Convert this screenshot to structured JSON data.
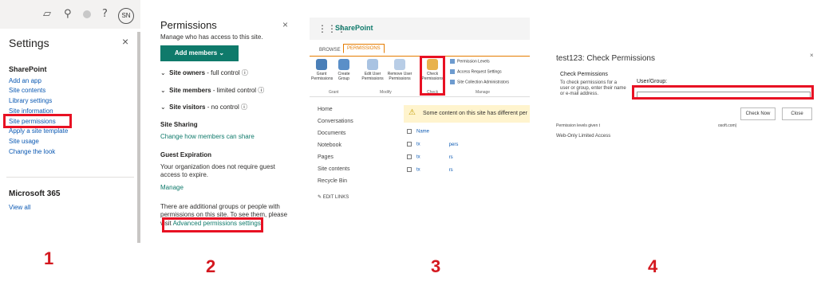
{
  "step_numbers": [
    "1",
    "2",
    "3",
    "4"
  ],
  "panel1": {
    "settings_title": "Settings",
    "close": "×",
    "avatar_initials": "SN",
    "help": "?",
    "section_sharepoint": "SharePoint",
    "items": [
      "Add an app",
      "Site contents",
      "Library settings",
      "Site information",
      "Site permissions",
      "Apply a site template",
      "Site usage",
      "Change the look"
    ],
    "section_m365": "Microsoft 365",
    "view_all": "View all"
  },
  "panel2": {
    "title": "Permissions",
    "close": "×",
    "subtitle": "Manage who has access to this site.",
    "add_members": "Add members ⌄",
    "groups": [
      {
        "name": "Site owners",
        "level": " - full control ⓘ"
      },
      {
        "name": "Site members",
        "level": " - limited control ⓘ"
      },
      {
        "name": "Site visitors",
        "level": " - no control ⓘ"
      }
    ],
    "site_sharing_heading": "Site Sharing",
    "site_sharing_link": "Change how members can share",
    "guest_heading": "Guest Expiration",
    "guest_text_1": "Your organization does not require guest",
    "guest_text_2": "access to expire.",
    "manage": "Manage",
    "additional_1": "There are additional groups or people with",
    "additional_2": "permissions on this site. To see them, please",
    "additional_3": "visit ",
    "advanced_link": "Advanced permissions settings",
    "period": "."
  },
  "panel3": {
    "brand": "SharePoint",
    "tabs": [
      "BROWSE",
      "PERMISSIONS"
    ],
    "ribbon_buttons": [
      "Grant Permissions",
      "Create Group",
      "Edit User Permissions",
      "Remove User Permissions",
      "Check Permissions"
    ],
    "ribbon_small": [
      "Permission Levels",
      "Access Request Settings",
      "Site Collection Administrators"
    ],
    "group_labels": [
      "Grant",
      "Modify",
      "Check",
      "Manage"
    ],
    "nav": [
      "Home",
      "Conversations",
      "Documents",
      "Notebook",
      "Pages",
      "Site contents",
      "Recycle Bin"
    ],
    "edit_links": "EDIT LINKS",
    "warning": "Some content on this site has different per",
    "list_header": "Name",
    "rows": [
      {
        "a": "tx",
        "b": "pers"
      },
      {
        "a": "tx",
        "b": "rs"
      },
      {
        "a": "tx",
        "b": "rs"
      }
    ]
  },
  "panel4": {
    "title": "test123: Check Permissions",
    "close": "×",
    "section_heading": "Check Permissions",
    "description": "To check permissions for a user or group, enter their name or e-mail address.",
    "user_group_label": "User/Group:",
    "input_value": "",
    "check_now": "Check Now",
    "close_button": "Close",
    "result_label": "Permission levels given t",
    "result_suffix": "osoft.com)",
    "result_value": "Web-Only Limited Access"
  }
}
